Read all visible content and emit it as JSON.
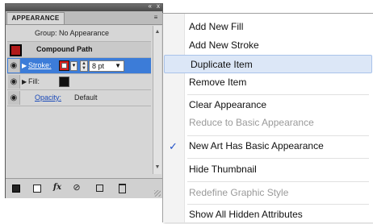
{
  "panel": {
    "title": "APPEARANCE",
    "collapse_glyph": "«",
    "close_glyph": "x",
    "menu_glyph": "≡",
    "group_label": "Group: No Appearance",
    "compound_label": "Compound Path",
    "compound_swatch_color": "#b11a1a",
    "stroke": {
      "label": "Stroke:",
      "swatch_color": "#d91c1c",
      "weight": "8 pt"
    },
    "fill": {
      "label": "Fill:",
      "swatch_color": "#111111"
    },
    "opacity": {
      "label": "Opacity:",
      "value": "Default"
    },
    "highlight_color": "#3c7cd8",
    "footer_icons": [
      "new-art-basic-icon",
      "clear-appearance-icon",
      "fx-icon",
      "reduce-icon",
      "duplicate-icon",
      "trash-icon"
    ],
    "fx_label": "fx",
    "reduce_glyph": "⊘"
  },
  "menu": {
    "items": [
      {
        "label": "Add New Fill",
        "disabled": false
      },
      {
        "label": "Add New Stroke",
        "disabled": false
      },
      {
        "label": "Duplicate Item",
        "disabled": false,
        "hover": true
      },
      {
        "label": "Remove Item",
        "disabled": false
      },
      {
        "label": "Clear Appearance",
        "disabled": false
      },
      {
        "label": "Reduce to Basic Appearance",
        "disabled": true
      },
      {
        "label": "New Art Has Basic Appearance",
        "disabled": false,
        "checked": true
      },
      {
        "label": "Hide Thumbnail",
        "disabled": false
      },
      {
        "label": "Redefine Graphic Style",
        "disabled": true
      },
      {
        "label": "Show All Hidden Attributes",
        "disabled": false
      }
    ],
    "check_glyph": "✓",
    "hover_color": "#dce7f7"
  }
}
